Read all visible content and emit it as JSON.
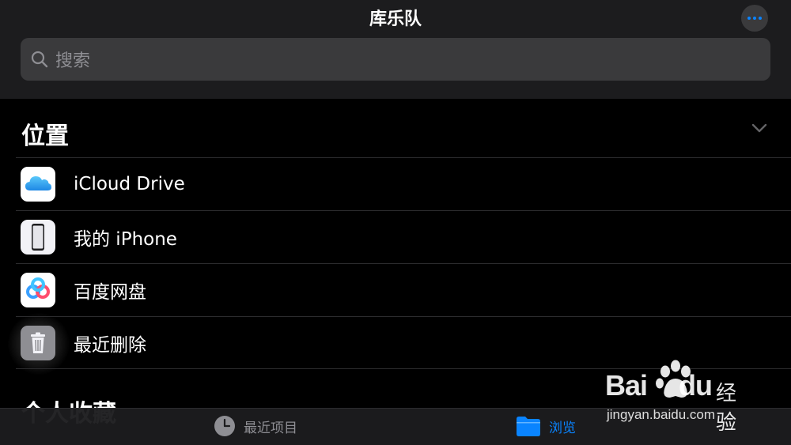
{
  "header": {
    "title": "库乐队",
    "more_icon": "ellipsis-icon"
  },
  "search": {
    "placeholder": "搜索",
    "icon": "search-icon"
  },
  "locations": {
    "heading": "位置",
    "collapse_icon": "chevron-down-icon",
    "items": [
      {
        "label": "iCloud Drive",
        "icon": "icloud-icon"
      },
      {
        "label": "我的 iPhone",
        "icon": "iphone-icon"
      },
      {
        "label": "百度网盘",
        "icon": "baidu-netdisk-icon"
      },
      {
        "label": "最近删除",
        "icon": "trash-icon"
      }
    ]
  },
  "favorites": {
    "heading": "个人收藏"
  },
  "tabbar": {
    "recent_label": "最近项目",
    "browse_label": "浏览",
    "active_tab": "浏览"
  },
  "watermark": {
    "brand": "Bai",
    "brand_suffix": "du",
    "jingyan": "经验",
    "url": "jingyan.baidu.com"
  },
  "colors": {
    "accent": "#0a84ff",
    "background": "#000000",
    "header_bg": "#1c1c1e",
    "search_bg": "#3a3a3c",
    "secondary_text": "#8e8e93"
  }
}
